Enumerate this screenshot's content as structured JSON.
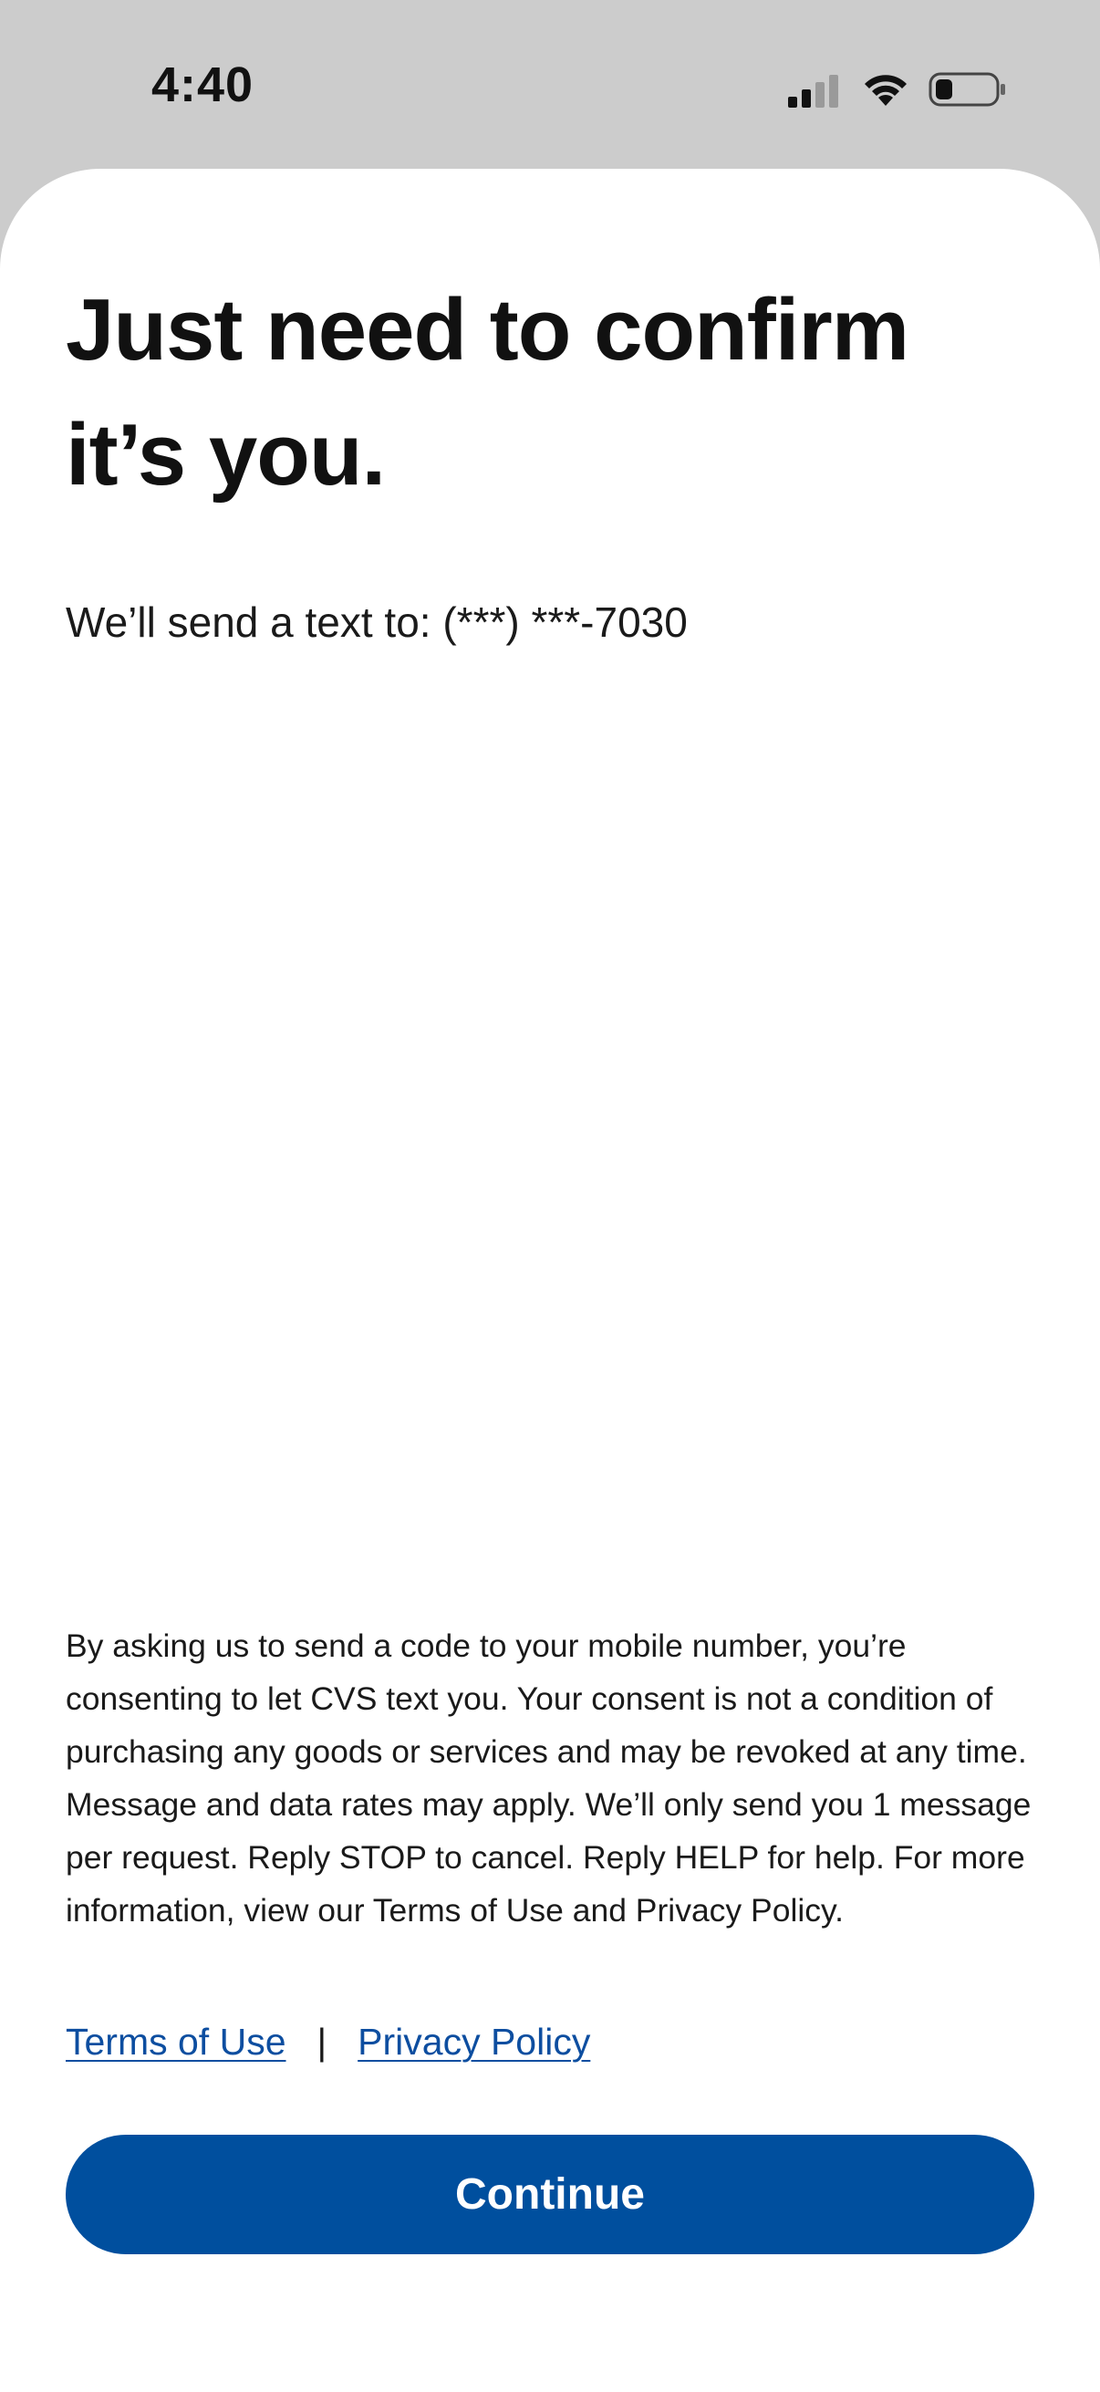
{
  "status_bar": {
    "time": "4:40",
    "icons": [
      "signal-icon",
      "wifi-icon",
      "battery-icon"
    ]
  },
  "page": {
    "title": "Just need to confirm it’s you.",
    "send_text": "We’ll send a text to: (***) ***-7030",
    "consent": "By asking us to send a code to your mobile number, you’re consenting to let CVS text you. Your consent is not a condition of purchasing any goods or services and may be revoked at any time. Message and data rates may apply. We’ll only send you 1 message per request. Reply STOP to cancel. Reply HELP for help. For more information, view our Terms of Use and Privacy Policy.",
    "links": {
      "terms": "Terms of Use",
      "separator": "|",
      "privacy": "Privacy Policy"
    },
    "continue_label": "Continue"
  },
  "colors": {
    "status_bar_bg": "#cccccc",
    "sheet_bg": "#ffffff",
    "primary_button": "#004f9e",
    "link": "#0d4ea0"
  }
}
